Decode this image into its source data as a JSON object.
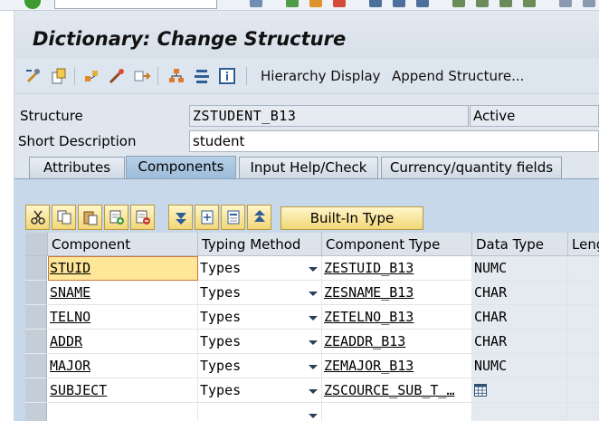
{
  "window": {
    "title": "Dictionary: Change Structure"
  },
  "toolbar": {
    "icons": [
      "display-change-icon",
      "other-object-icon",
      "where-used-icon",
      "activate-icon",
      "check-icon",
      "hierarchy-icon",
      "append-icon",
      "info-icon"
    ],
    "hierarchy_display_label": "Hierarchy Display",
    "append_structure_label": "Append Structure..."
  },
  "header": {
    "structure_label": "Structure",
    "structure_value": "ZSTUDENT_B13",
    "status": "Active",
    "short_desc_label": "Short Description",
    "short_desc_value": "student"
  },
  "tabs": [
    {
      "label": "Attributes",
      "active": false
    },
    {
      "label": "Components",
      "active": true
    },
    {
      "label": "Input Help/Check",
      "active": false
    },
    {
      "label": "Currency/quantity fields",
      "active": false
    }
  ],
  "table_toolbar": {
    "icons": [
      "cut-icon",
      "copy-icon",
      "paste-icon",
      "insert-row-icon",
      "delete-row-icon",
      "expand-icon",
      "new-entry-icon",
      "select-icon",
      "collapse-icon"
    ],
    "builtin_type_label": "Built-In Type"
  },
  "grid": {
    "columns": [
      "Component",
      "Typing Method",
      "Component Type",
      "Data Type",
      "Leng"
    ],
    "rows": [
      {
        "component": "STUID",
        "typing": "Types",
        "comp_type": "ZESTUID_B13",
        "data_type": "NUMC"
      },
      {
        "component": "SNAME",
        "typing": "Types",
        "comp_type": "ZESNAME_B13",
        "data_type": "CHAR"
      },
      {
        "component": "TELNO",
        "typing": "Types",
        "comp_type": "ZETELNO_B13",
        "data_type": "CHAR"
      },
      {
        "component": "ADDR",
        "typing": "Types",
        "comp_type": "ZEADDR_B13",
        "data_type": "CHAR"
      },
      {
        "component": "MAJOR",
        "typing": "Types",
        "comp_type": "ZEMAJOR_B13",
        "data_type": "NUMC"
      },
      {
        "component": "SUBJECT",
        "typing": "Types",
        "comp_type": "ZSCOURCE_SUB_T_…",
        "data_type": ""
      },
      {
        "component": "",
        "typing": "",
        "comp_type": "",
        "data_type": ""
      }
    ]
  },
  "colors": {
    "active_tab": "#a9c6e2",
    "focus_cell": "#ffe79a",
    "button_gold": "#f2d677"
  }
}
